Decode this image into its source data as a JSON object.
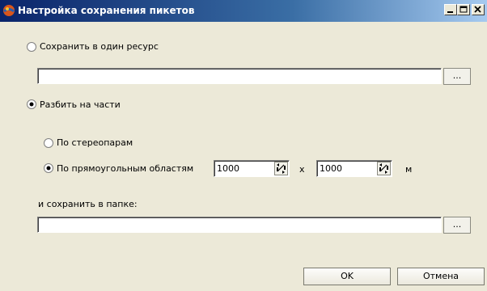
{
  "window": {
    "title": "Настройка сохранения пикетов"
  },
  "options": {
    "single_resource": {
      "label": "Сохранить в один ресурс",
      "selected": false,
      "path_value": "",
      "browse_label": "..."
    },
    "split": {
      "label": "Разбить на части",
      "selected": true,
      "by_stereopairs": {
        "label": "По стереопарам",
        "selected": false
      },
      "by_rectangles": {
        "label": "По прямоугольным областям",
        "selected": true,
        "width_value": "1000",
        "times_symbol": "x",
        "height_value": "1000",
        "unit": "м"
      },
      "folder": {
        "label": "и сохранить в папке:",
        "path_value": "",
        "browse_label": "..."
      }
    }
  },
  "buttons": {
    "ok_label": "OK",
    "cancel_label": "Отмена"
  },
  "colors": {
    "face": "#ece9d8",
    "title_gradient_start": "#0a246a",
    "title_gradient_end": "#a6caf0"
  }
}
